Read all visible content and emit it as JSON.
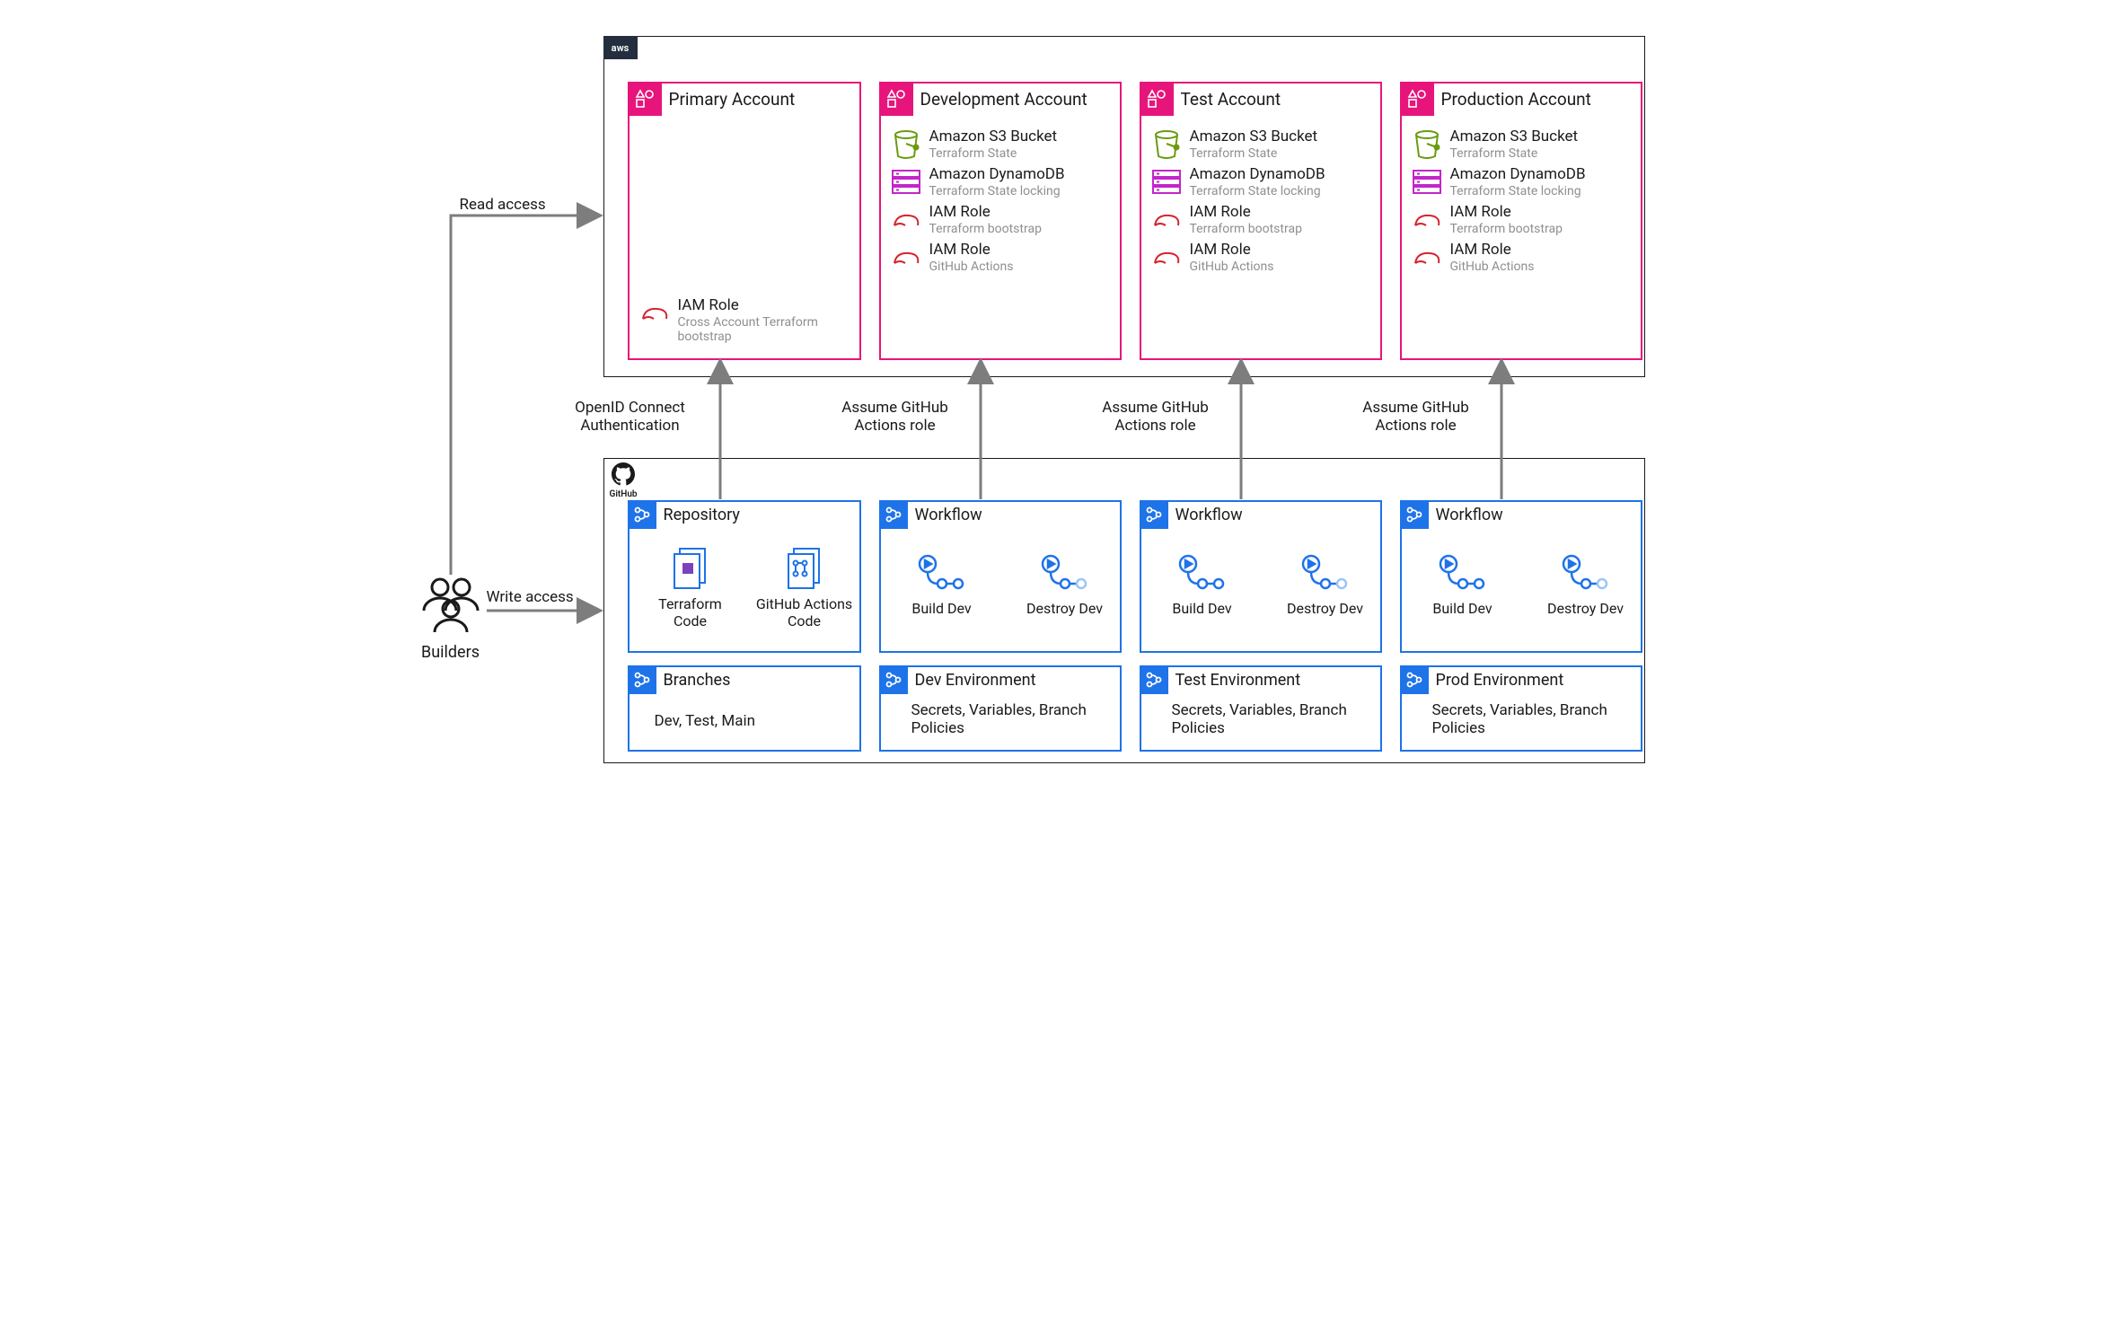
{
  "builders_label": "Builders",
  "aws_label": "aws",
  "github_label": "GitHub",
  "edges": {
    "read_access": "Read access",
    "write_access": "Write access",
    "openid": "OpenID Connect Authentication",
    "assume": "Assume GitHub Actions role"
  },
  "accounts": {
    "primary": {
      "title": "Primary Account",
      "iam_role": "IAM Role",
      "iam_sub": "Cross Account Terraform bootstrap"
    },
    "dev": {
      "title": "Development Account"
    },
    "test": {
      "title": "Test Account"
    },
    "prod": {
      "title": "Production Account"
    },
    "resources": {
      "s3": {
        "title": "Amazon S3 Bucket",
        "sub": "Terraform State"
      },
      "dynamo": {
        "title": "Amazon DynamoDB",
        "sub": "Terraform State locking"
      },
      "iam_boot": {
        "title": "IAM Role",
        "sub": "Terraform bootstrap"
      },
      "iam_gha": {
        "title": "IAM Role",
        "sub": "GitHub Actions"
      }
    }
  },
  "github": {
    "repository": {
      "title": "Repository",
      "tf_code": "Terraform Code",
      "gha_code": "GitHub Actions Code"
    },
    "branches": {
      "title": "Branches",
      "body": "Dev, Test, Main"
    },
    "workflow": {
      "title": "Workflow",
      "build": "Build Dev",
      "destroy": "Destroy Dev"
    },
    "env": {
      "dev": "Dev Environment",
      "test": "Test Environment",
      "prod": "Prod Environment",
      "body": "Secrets, Variables, Branch Policies"
    }
  }
}
